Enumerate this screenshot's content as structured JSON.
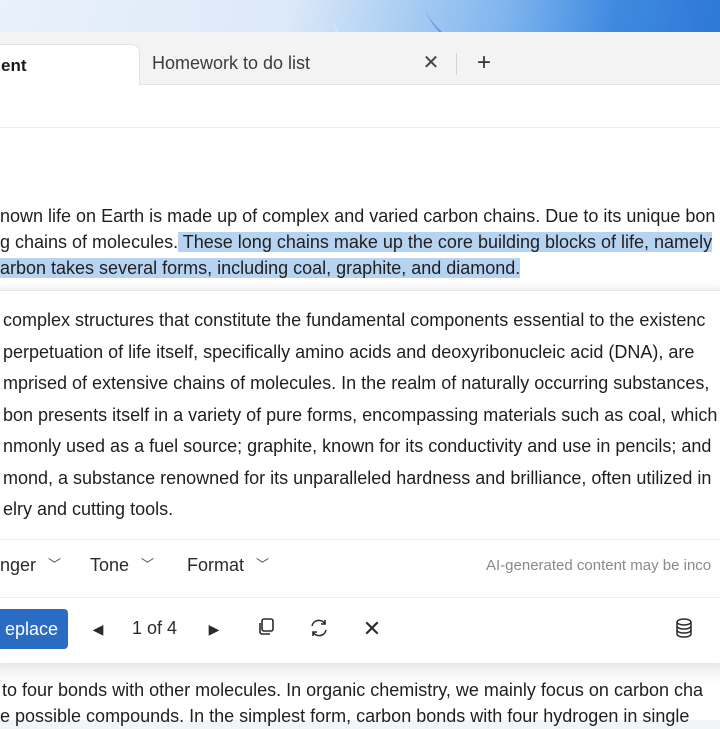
{
  "tabs": [
    {
      "label": "ent",
      "active": true
    },
    {
      "label": "Homework to do list",
      "active": false
    }
  ],
  "document": {
    "line1": "nown life on Earth is made up of complex and varied carbon chains. Due to its unique bon",
    "line2_plain": "g chains of molecules.",
    "line2_highlight": " These long chains make up the core building blocks of life, namely",
    "line3_highlight": "arbon takes several forms, including coal, graphite, and diamond.",
    "bottom_line1": "to four bonds with other molecules. In organic chemistry, we mainly focus on carbon cha",
    "bottom_line2": "e possible compounds. In the simplest form, carbon bonds with four hydrogen in single"
  },
  "rewrite_panel": {
    "suggestion_lines": [
      "complex structures that constitute the fundamental components essential to the existenc",
      "perpetuation of life itself, specifically amino acids and deoxyribonucleic acid (DNA), are",
      "mprised of extensive chains of molecules. In the realm of naturally occurring substances,",
      "bon presents itself in a variety of pure forms, encompassing materials such as coal, which",
      "nmonly used as a fuel source; graphite, known for its conductivity and use in pencils; and",
      "mond, a substance renowned for its unparalleled hardness and brilliance, often utilized in",
      "elry and cutting tools."
    ],
    "options": {
      "length_label": "nger",
      "tone_label": "Tone",
      "format_label": "Format"
    },
    "disclaimer": "AI-generated content may be inco",
    "replace_label": "eplace",
    "pager": "1 of 4",
    "accent_color": "#2a6bc4",
    "highlight_color": "#b7d3f2"
  }
}
